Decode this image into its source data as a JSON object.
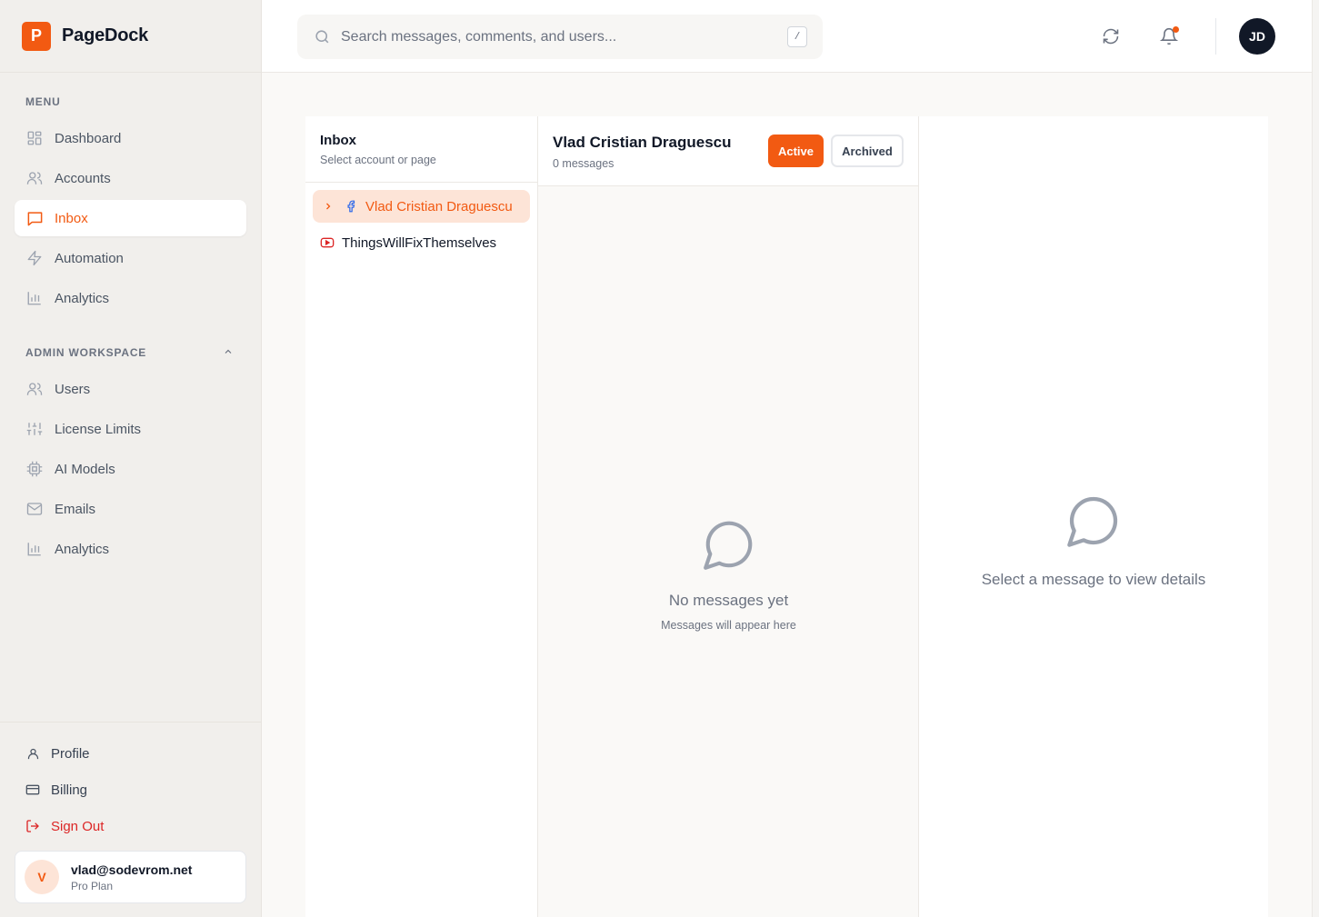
{
  "brand": {
    "logo_letter": "P",
    "name": "PageDock",
    "accent": "#f25a12"
  },
  "menu": {
    "label": "MENU",
    "items": [
      {
        "label": "Dashboard",
        "icon": "dashboard-icon"
      },
      {
        "label": "Accounts",
        "icon": "users-icon"
      },
      {
        "label": "Inbox",
        "icon": "message-square-icon",
        "active": true
      },
      {
        "label": "Automation",
        "icon": "lightning-icon"
      },
      {
        "label": "Analytics",
        "icon": "bar-chart-icon"
      }
    ]
  },
  "admin": {
    "label": "ADMIN WORKSPACE",
    "items": [
      {
        "label": "Users",
        "icon": "users-icon"
      },
      {
        "label": "License Limits",
        "icon": "sliders-icon"
      },
      {
        "label": "AI Models",
        "icon": "cpu-icon"
      },
      {
        "label": "Emails",
        "icon": "mail-icon"
      },
      {
        "label": "Analytics",
        "icon": "bar-chart-icon"
      }
    ]
  },
  "footer": {
    "items": [
      {
        "label": "Profile",
        "icon": "user-icon"
      },
      {
        "label": "Billing",
        "icon": "credit-card-icon"
      },
      {
        "label": "Sign Out",
        "icon": "logout-icon"
      }
    ],
    "user": {
      "initial": "V",
      "email": "vlad@sodevrom.net",
      "plan": "Pro Plan"
    }
  },
  "header": {
    "search_placeholder": "Search messages, comments, and users...",
    "shortcut": "/",
    "avatar_initials": "JD"
  },
  "inbox": {
    "title": "Inbox",
    "subtitle": "Select account or page",
    "accounts": [
      {
        "name": "Vlad Cristian Draguescu",
        "platform": "facebook",
        "selected": true
      },
      {
        "name": "ThingsWillFixThemselves",
        "platform": "youtube",
        "selected": false
      }
    ]
  },
  "messages": {
    "title": "Vlad Cristian Draguescu",
    "count_text": "0 messages",
    "active_label": "Active",
    "archived_label": "Archived",
    "empty_title": "No messages yet",
    "empty_sub": "Messages will appear here"
  },
  "detail": {
    "empty_text": "Select a message to view details"
  }
}
